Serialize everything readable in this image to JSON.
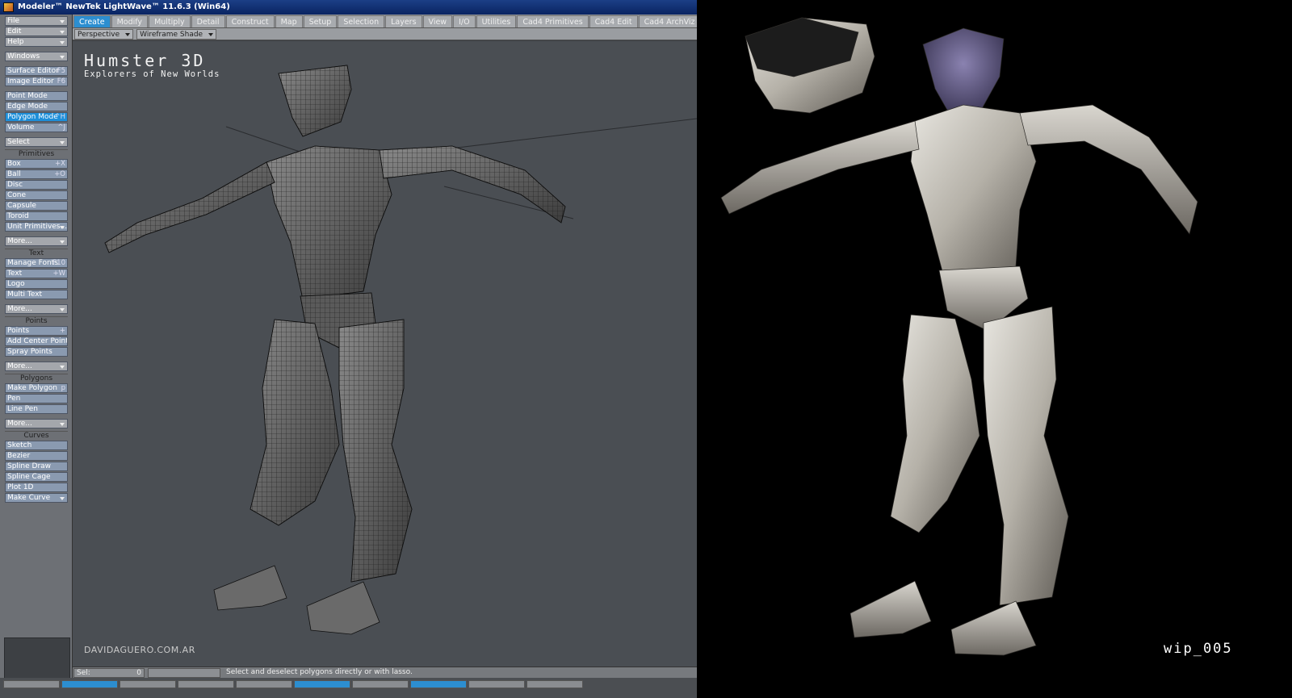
{
  "window": {
    "title": "Modeler™ NewTek LightWave™ 11.6.3 (Win64)"
  },
  "tabs": [
    "Create",
    "Modify",
    "Multiply",
    "Detail",
    "Construct",
    "Map",
    "Setup",
    "Selection",
    "Layers",
    "View",
    "I/O",
    "Utilities",
    "Cad4 Primitives",
    "Cad4 Edit",
    "Cad4 ArchViz"
  ],
  "active_tab": "Create",
  "viewport_header": {
    "view": "Perspective",
    "shading": "Wireframe Shade"
  },
  "toolbar": {
    "menus": {
      "file": "File",
      "edit": "Edit",
      "help": "Help",
      "windows": "Windows"
    },
    "surface_editor": {
      "label": "Surface Editor",
      "key": "F5"
    },
    "image_editor": {
      "label": "Image Editor",
      "key": "F6"
    },
    "modes": {
      "point": "Point Mode",
      "edge": "Edge Mode",
      "polygon": "Polygon Mode",
      "polygon_key": "^H",
      "volume": "Volume",
      "volume_key": "^J"
    },
    "select": "Select",
    "primitives": {
      "header": "Primitives",
      "box": "Box",
      "box_key": "+X",
      "ball": "Ball",
      "ball_key": "+O",
      "disc": "Disc",
      "cone": "Cone",
      "capsule": "Capsule",
      "toroid": "Toroid",
      "unit": "Unit Primitives...",
      "more": "More..."
    },
    "text": {
      "header": "Text",
      "manage_fonts": "Manage Fonts",
      "manage_fonts_key": "F10",
      "text": "Text",
      "text_key": "+W",
      "logo": "Logo",
      "multi_text": "Multi Text",
      "more": "More..."
    },
    "points": {
      "header": "Points",
      "points": "Points",
      "points_key": "+",
      "add_center": "Add Center Point",
      "spray": "Spray Points",
      "more": "More..."
    },
    "polygons": {
      "header": "Polygons",
      "make_polygon": "Make Polygon",
      "make_polygon_key": "p",
      "pen": "Pen",
      "line_pen": "Line Pen",
      "more": "More..."
    },
    "curves": {
      "header": "Curves",
      "sketch": "Sketch",
      "bezier": "Bezier",
      "spline_draw": "Spline Draw",
      "spline_cage": "Spline Cage",
      "plot_1d": "Plot 1D",
      "make_curve": "Make Curve"
    }
  },
  "viewport": {
    "logo_line1": "Humster 3D",
    "logo_line2": "Explorers of New Worlds",
    "credit": "DAVIDAGUERO.COM.AR"
  },
  "status": {
    "sel_label": "Sel:",
    "sel_value": "0",
    "hint": "Select and deselect polygons directly or with lasso."
  },
  "render": {
    "label": "wip_005"
  },
  "colors": {
    "accent": "#2c8ed0",
    "viewport_bg": "#4a4e53",
    "render_bg": "#000000"
  }
}
